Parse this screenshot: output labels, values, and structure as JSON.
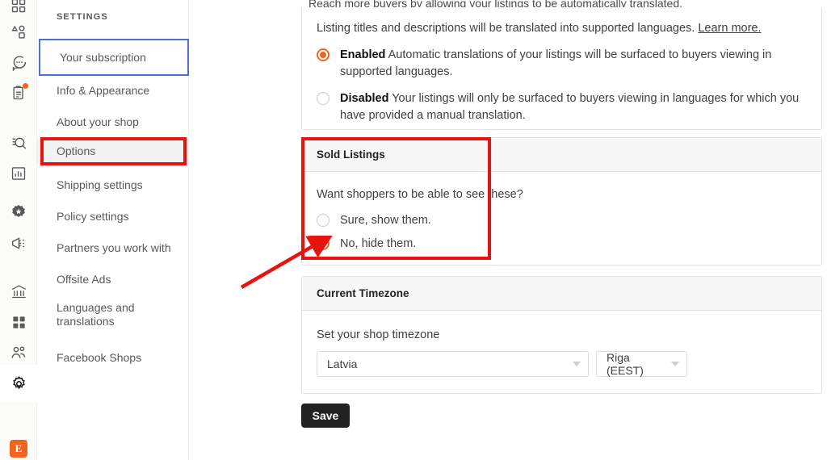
{
  "app": {
    "brand_initial": "E",
    "accent_color": "#f1641e",
    "annotation_color": "#e8120e",
    "focus_ring_color": "#4a6fdc"
  },
  "icon_rail": {
    "items": [
      {
        "name": "dashboard-icon",
        "label": "Dashboard",
        "active": false,
        "badge": false
      },
      {
        "name": "listings-icon",
        "label": "Listings",
        "active": false,
        "badge": false
      },
      {
        "name": "messages-icon",
        "label": "Messages",
        "active": false,
        "badge": false
      },
      {
        "name": "orders-icon",
        "label": "Orders and Shipping",
        "active": false,
        "badge": true
      },
      {
        "name": "seo-search-icon",
        "label": "Search Analytics",
        "active": false,
        "badge": false
      },
      {
        "name": "stats-icon",
        "label": "Stats",
        "active": false,
        "badge": false
      },
      {
        "name": "star-badge-icon",
        "label": "Star Seller",
        "active": false,
        "badge": false
      },
      {
        "name": "marketing-megaphone-icon",
        "label": "Marketing",
        "active": false,
        "badge": false
      },
      {
        "name": "finances-bank-icon",
        "label": "Finances",
        "active": false,
        "badge": false
      },
      {
        "name": "integrations-grid-icon",
        "label": "Integrations",
        "active": false,
        "badge": false
      },
      {
        "name": "community-people-icon",
        "label": "Community",
        "active": false,
        "badge": false
      },
      {
        "name": "settings-gear-icon",
        "label": "Settings",
        "active": true,
        "badge": false
      }
    ]
  },
  "sidebar": {
    "heading": "SETTINGS",
    "items": [
      {
        "label": "Your subscription",
        "state": "focused"
      },
      {
        "label": "Info & Appearance",
        "state": "normal"
      },
      {
        "label": "About your shop",
        "state": "normal"
      },
      {
        "label": "Options",
        "state": "selected"
      },
      {
        "label": "Shipping settings",
        "state": "normal"
      },
      {
        "label": "Policy settings",
        "state": "normal"
      },
      {
        "label": "Partners you work with",
        "state": "normal"
      },
      {
        "label": "Offsite Ads",
        "state": "normal"
      },
      {
        "label": "Languages and translations",
        "state": "normal"
      },
      {
        "label": "Facebook Shops",
        "state": "normal"
      }
    ]
  },
  "main": {
    "cut_off_lead": "Reach more buyers by allowing your listings to be automatically translated.",
    "translations_card": {
      "description_prefix": "Listing titles and descriptions will be translated into supported languages.",
      "learn_more_label": "Learn more.",
      "options": [
        {
          "bold": "Enabled",
          "text": "Automatic translations of your listings will be surfaced to buyers viewing in supported languages.",
          "checked": true
        },
        {
          "bold": "Disabled",
          "text": "Your listings will only be surfaced to buyers viewing in languages for which you have provided a manual translation.",
          "checked": false
        }
      ]
    },
    "sold_listings_card": {
      "title": "Sold Listings",
      "question": "Want shoppers to be able to see these?",
      "options": [
        {
          "label": "Sure, show them.",
          "checked": false
        },
        {
          "label": "No, hide them.",
          "checked": true
        }
      ]
    },
    "timezone_card": {
      "title": "Current Timezone",
      "field_label": "Set your shop timezone",
      "country_value": "Latvia",
      "city_value": "Riga (EEST)"
    },
    "save_label": "Save"
  }
}
